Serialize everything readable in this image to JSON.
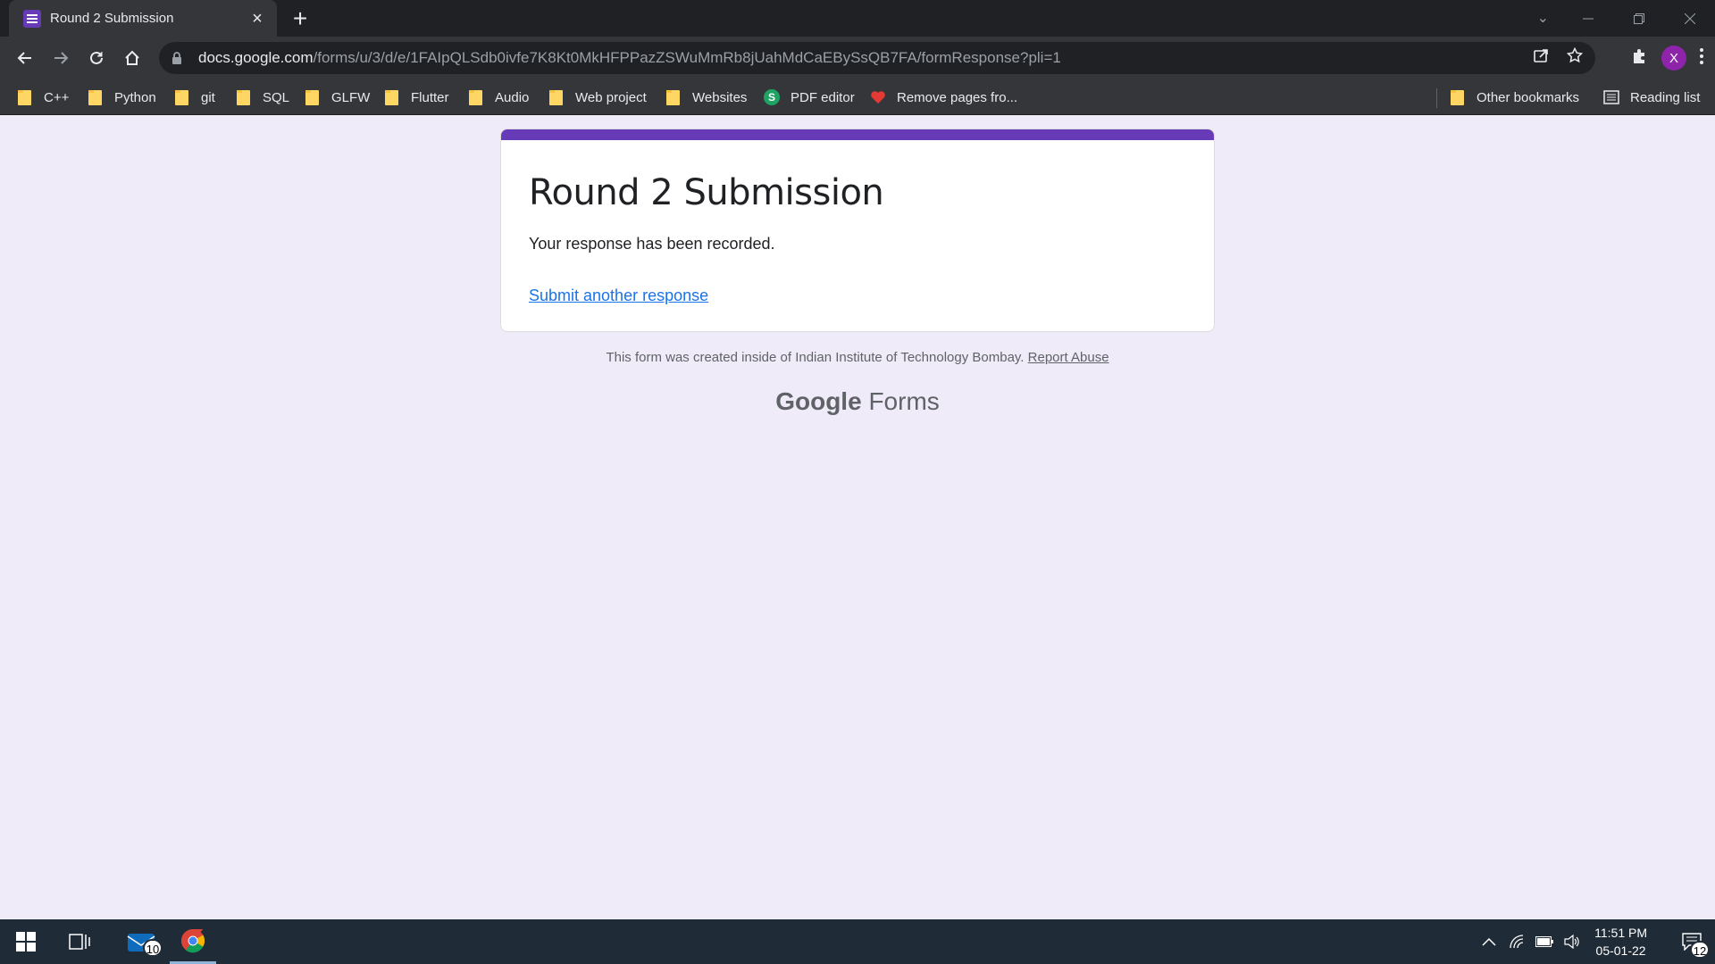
{
  "browser": {
    "tab": {
      "title": "Round 2 Submission"
    },
    "url": {
      "host": "docs.google.com",
      "path": "/forms/u/3/d/e/1FAIpQLSdb0ivfe7K8Kt0MkHFPPazZSWuMmRb8jUahMdCaEBySsQB7FA/formResponse?pli=1"
    },
    "profile_initial": "X",
    "bookmarks": [
      "C++",
      "Python",
      "git",
      "SQL",
      "GLFW",
      "Flutter",
      "Audio",
      "Web project",
      "Websites",
      "PDF editor",
      "Remove pages fro..."
    ],
    "other_bookmarks": "Other bookmarks",
    "reading_list": "Reading list"
  },
  "form": {
    "title": "Round 2 Submission",
    "message": "Your response has been recorded.",
    "another_link": "Submit another response",
    "footer_text": "This form was created inside of Indian Institute of Technology Bombay.",
    "report_abuse": "Report Abuse",
    "brand_google": "Google",
    "brand_forms": "Forms"
  },
  "taskbar": {
    "mail_badge": "10",
    "notifications_badge": "12",
    "time": "11:51 PM",
    "date": "05-01-22"
  },
  "colors": {
    "accent": "#673ab7",
    "page_bg": "#f0ebf8",
    "link": "#1a73e8"
  }
}
